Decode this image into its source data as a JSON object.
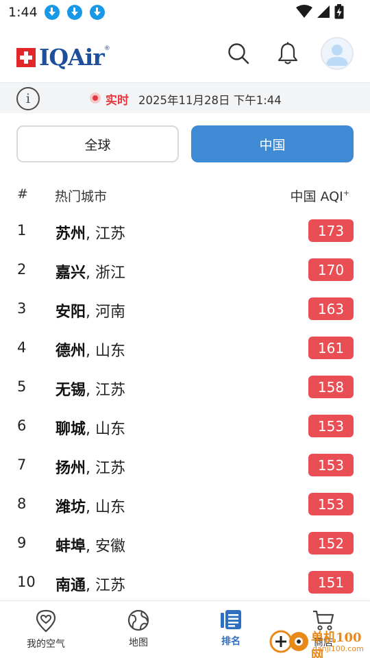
{
  "status_bar": {
    "time": "1:44",
    "download_icons": 3
  },
  "header": {
    "logo_text": "IQAir",
    "logo_registered": "®",
    "search_icon": "search-icon",
    "bell_icon": "bell-icon",
    "avatar_icon": "user-avatar-icon"
  },
  "info_bar": {
    "info_symbol": "i",
    "live_label": "实时",
    "timestamp": "2025年11月28日 下午1:44"
  },
  "tabs": {
    "global": "全球",
    "china": "中国",
    "active": "china",
    "active_color": "#3f8ad4"
  },
  "list_header": {
    "rank": "#",
    "city": "热门城市",
    "aqi": "中国 AQI",
    "aqi_plus": "+"
  },
  "ranking": [
    {
      "rank": "1",
      "city": "苏州",
      "province": ", 江苏",
      "aqi": "173"
    },
    {
      "rank": "2",
      "city": "嘉兴",
      "province": ", 浙江",
      "aqi": "170"
    },
    {
      "rank": "3",
      "city": "安阳",
      "province": ", 河南",
      "aqi": "163"
    },
    {
      "rank": "4",
      "city": "德州",
      "province": ", 山东",
      "aqi": "161"
    },
    {
      "rank": "5",
      "city": "无锡",
      "province": ", 江苏",
      "aqi": "158"
    },
    {
      "rank": "6",
      "city": "聊城",
      "province": ", 山东",
      "aqi": "153"
    },
    {
      "rank": "7",
      "city": "扬州",
      "province": ", 江苏",
      "aqi": "153"
    },
    {
      "rank": "8",
      "city": "潍坊",
      "province": ", 山东",
      "aqi": "153"
    },
    {
      "rank": "9",
      "city": "蚌埠",
      "province": ", 安徽",
      "aqi": "152"
    },
    {
      "rank": "10",
      "city": "南通",
      "province": ", 江苏",
      "aqi": "151"
    }
  ],
  "aqi_badge_color": "#ea4e55",
  "bottom_nav": [
    {
      "label": "我的空气",
      "icon": "heart-location-icon",
      "active": false
    },
    {
      "label": "地图",
      "icon": "globe-icon",
      "active": false
    },
    {
      "label": "排名",
      "icon": "ranking-list-icon",
      "active": true
    },
    {
      "label": "商店",
      "icon": "cart-icon",
      "active": false
    }
  ],
  "watermark": {
    "title": "单机100网",
    "url": "danji100.com"
  }
}
